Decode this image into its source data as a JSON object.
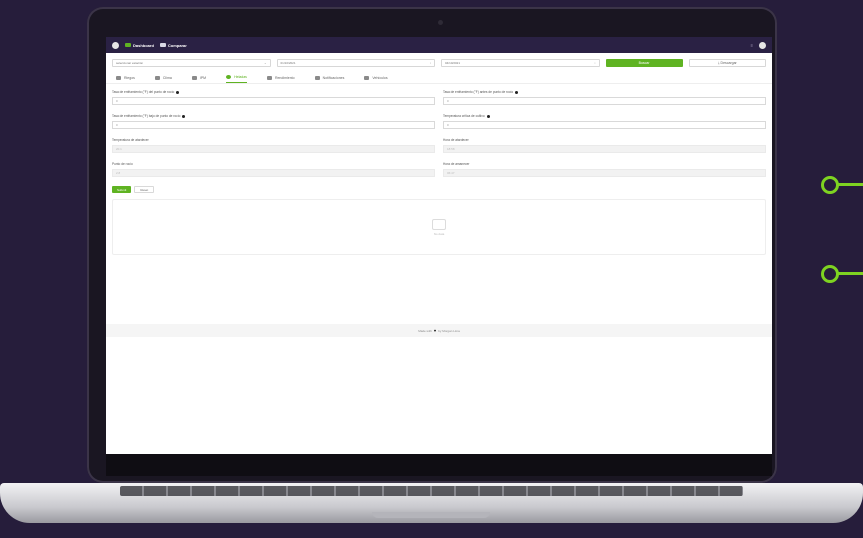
{
  "topbar": {
    "dashboard_label": "Dashboard",
    "compare_label": "Comparar"
  },
  "filters": {
    "station": "seleccionar estación",
    "date_from": "01/10/2021",
    "date_to": "04/10/2021",
    "search_label": "Buscar",
    "download_label": "Descargar"
  },
  "tabs": [
    {
      "label": "Riegos",
      "active": false
    },
    {
      "label": "Clima",
      "active": false
    },
    {
      "label": "IPM",
      "active": false
    },
    {
      "label": "Heladas",
      "active": true
    },
    {
      "label": "Rendimiento",
      "active": false
    },
    {
      "label": "Notificaciones",
      "active": false
    },
    {
      "label": "Vehículos",
      "active": false
    }
  ],
  "form": {
    "left": [
      {
        "label": "Tasa de enfriamiento (°F) del punto de rocío",
        "value": "0",
        "disabled": false,
        "info": true
      },
      {
        "label": "Tasa de enfriamiento (°F) bajo de punto de rocío",
        "value": "0",
        "disabled": false,
        "info": true
      },
      {
        "label": "Temperatura de atardecer",
        "value": "20.1",
        "disabled": true,
        "info": false
      },
      {
        "label": "Punto de rocío",
        "value": "2.8",
        "disabled": true,
        "info": false
      }
    ],
    "right": [
      {
        "label": "Tasa de enfriamiento (°F) antes de punto de rocío",
        "value": "0",
        "disabled": false,
        "info": true
      },
      {
        "label": "Temperatura crítica de cultivo",
        "value": "0",
        "disabled": false,
        "info": true
      },
      {
        "label": "Hora de atardecer",
        "value": "18:58",
        "disabled": true,
        "info": false
      },
      {
        "label": "Hora de amanecer",
        "value": "06:47",
        "disabled": true,
        "info": false
      }
    ],
    "submit_label": "Submit",
    "reset_label": "Reset"
  },
  "empty_state": {
    "text": "No data"
  },
  "footer": {
    "left": "Made with",
    "right": "by Morgan Lima"
  },
  "colors": {
    "accent": "#5fb322",
    "topbar": "#2a2144",
    "background": "#261d3b"
  }
}
